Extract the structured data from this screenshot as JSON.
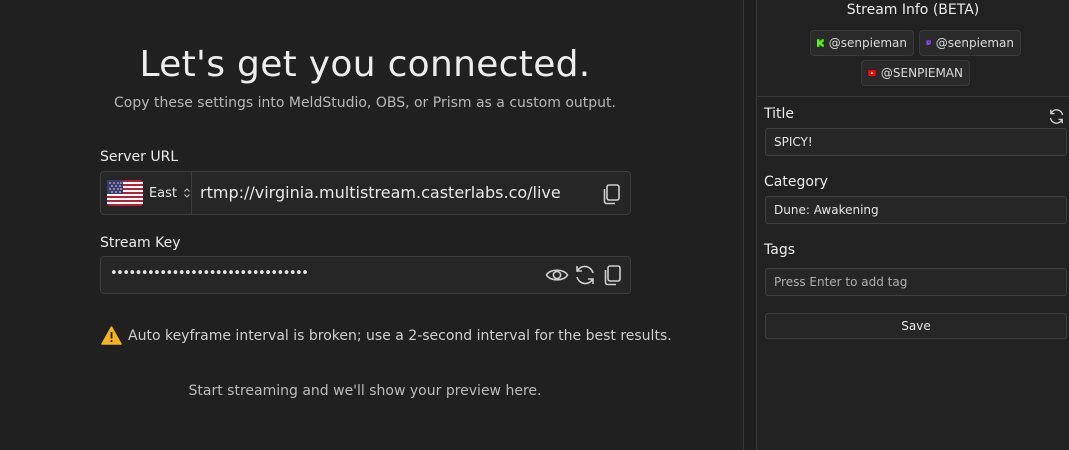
{
  "main": {
    "title": "Let's get you connected.",
    "subtitle": "Copy these settings into MeldStudio, OBS, or Prism as a custom output.",
    "server_url": {
      "label": "Server URL",
      "region": "East",
      "value": "rtmp://virginia.multistream.casterlabs.co/live"
    },
    "stream_key": {
      "label": "Stream Key",
      "masked_value": "••••••••••••••••••••••••••••••••"
    },
    "warning": "Auto keyframe interval is broken; use a 2-second interval for the best results.",
    "preview_placeholder": "Start streaming and we'll show your preview here."
  },
  "sidebar": {
    "title": "Stream Info (BETA)",
    "accounts": [
      {
        "platform": "kick",
        "handle": "@senpieman",
        "icon": "kick-icon",
        "color": "#53fc18"
      },
      {
        "platform": "twitch",
        "handle": "@senpieman",
        "icon": "twitch-icon",
        "color": "#9146ff"
      },
      {
        "platform": "youtube",
        "handle": "@SENPIEMAN",
        "icon": "youtube-icon",
        "color": "#ff0000"
      }
    ],
    "title_field": {
      "label": "Title",
      "value": "SPICY!"
    },
    "category_field": {
      "label": "Category",
      "value": "Dune: Awakening"
    },
    "tags_field": {
      "label": "Tags",
      "placeholder": "Press Enter to add tag"
    },
    "save_label": "Save"
  },
  "colors": {
    "background": "#202020",
    "warning": "#f5b324"
  }
}
